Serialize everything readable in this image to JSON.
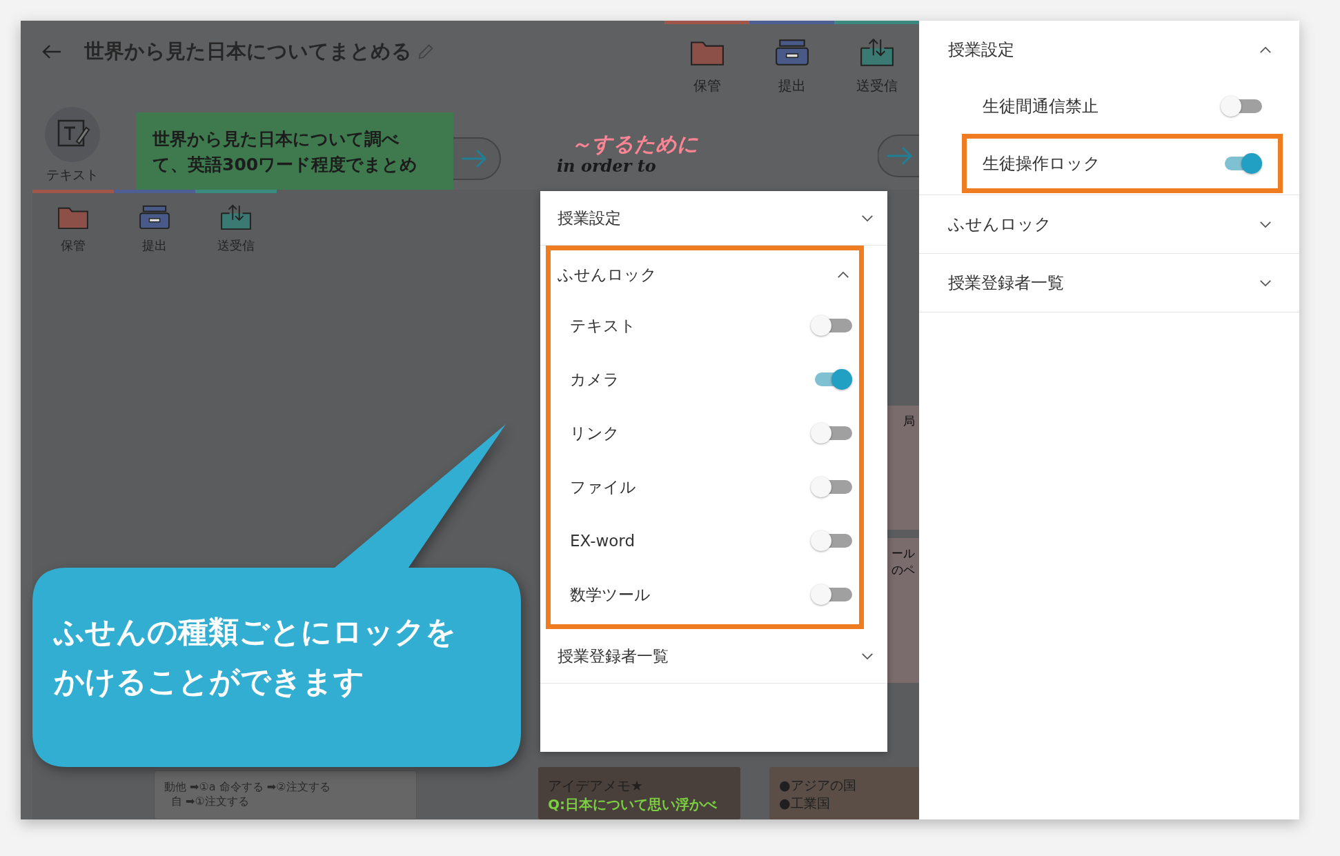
{
  "app": {
    "title": "世界から見た日本についてまとめる",
    "toolbar": [
      {
        "label": "保管",
        "kind": "folder"
      },
      {
        "label": "提出",
        "kind": "tray"
      },
      {
        "label": "送受信",
        "kind": "transfer"
      }
    ],
    "tool": {
      "label": "テキスト"
    },
    "task_card": {
      "lines": [
        "世界から見た日本について調べ",
        "て、英語300ワード程度でまとめ"
      ]
    },
    "handwriting": [
      {
        "text": "～するために",
        "color": "#ff8494"
      },
      {
        "text": "in order to",
        "color": "#1a1a1a"
      }
    ]
  },
  "inner_app": {
    "toolbar": [
      {
        "label": "保管",
        "kind": "folder"
      },
      {
        "label": "提出",
        "kind": "tray"
      },
      {
        "label": "送受信",
        "kind": "transfer"
      }
    ],
    "side_cards": [
      {
        "lines": [
          "局"
        ]
      },
      {
        "lines": [
          "ール",
          "のペ"
        ]
      }
    ],
    "bottom_cards": [
      {
        "lines": [
          "動他 ➡①a 命令する ➡②注文する",
          "自 ➡①注文する"
        ]
      },
      {
        "lines": [
          "アイデアメモ★",
          "Q:日本について思い浮かべ"
        ]
      },
      {
        "lines": [
          "●アジアの国",
          "●工業国"
        ]
      }
    ]
  },
  "popup": {
    "sections": [
      {
        "title": "授業設定",
        "expanded": false,
        "highlighted": false
      },
      {
        "title": "ふせんロック",
        "expanded": true,
        "highlighted": true,
        "toggles": [
          {
            "label": "テキスト",
            "on": false
          },
          {
            "label": "カメラ",
            "on": true
          },
          {
            "label": "リンク",
            "on": false
          },
          {
            "label": "ファイル",
            "on": false
          },
          {
            "label": "EX-word",
            "on": false
          },
          {
            "label": "数学ツール",
            "on": false
          }
        ]
      },
      {
        "title": "授業登録者一覧",
        "expanded": false,
        "highlighted": false
      }
    ]
  },
  "callout": {
    "lines": [
      "ふせんの種類ごとにロックを",
      "かけることができます"
    ]
  },
  "side_panel": {
    "sections": [
      {
        "title": "授業設定",
        "expanded": true,
        "toggles": [
          {
            "label": "生徒間通信禁止",
            "on": false,
            "highlighted": false
          },
          {
            "label": "生徒操作ロック",
            "on": true,
            "highlighted": true
          }
        ]
      },
      {
        "title": "ふせんロック",
        "expanded": false
      },
      {
        "title": "授業登録者一覧",
        "expanded": false
      }
    ]
  }
}
